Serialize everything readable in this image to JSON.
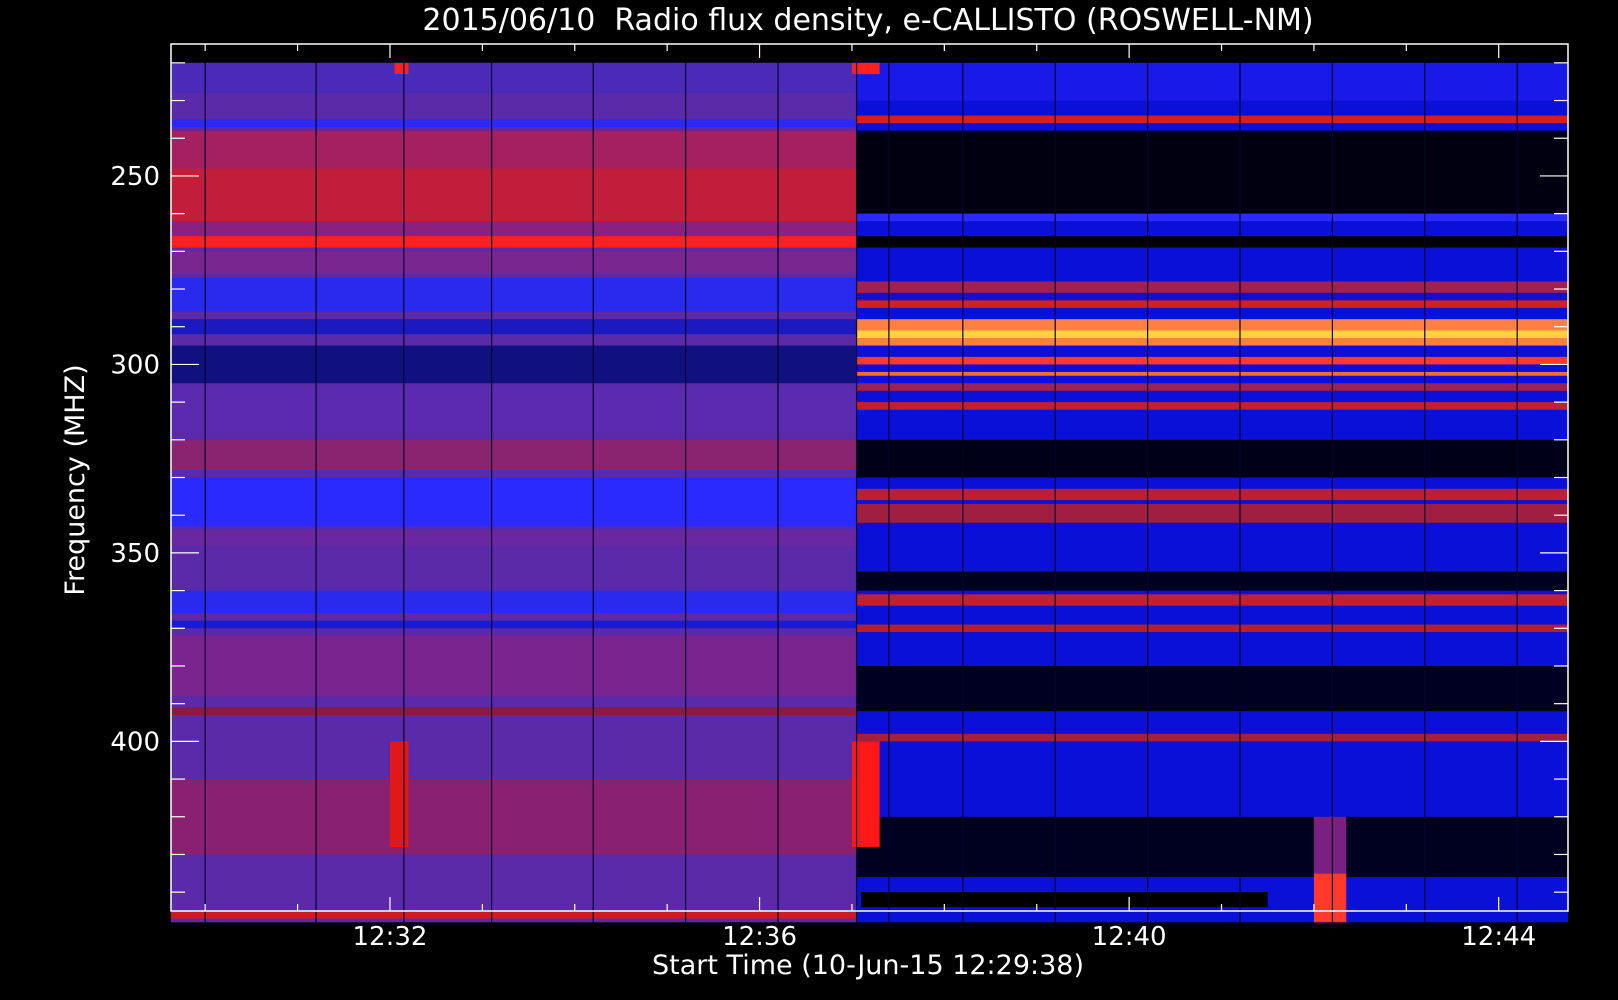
{
  "chart_data": {
    "type": "heatmap",
    "title": "2015/06/10  Radio flux density, e-CALLISTO (ROSWELL-NM)",
    "xlabel": "Start Time (10-Jun-15 12:29:38)",
    "ylabel": "Frequency (MHZ)",
    "x_ticks": [
      "12:32",
      "12:36",
      "12:40",
      "12:44"
    ],
    "y_ticks": [
      "250",
      "300",
      "350",
      "400"
    ],
    "x_tick_minutes": [
      32,
      36,
      40,
      44
    ],
    "y_tick_values": [
      250,
      300,
      350,
      400
    ],
    "xlim_minutes": [
      29.63,
      44.75
    ],
    "ylim_mhz": [
      445,
      215
    ],
    "y_inverted": true,
    "data_time_range_minutes": [
      29.63,
      44.75
    ],
    "data_freq_range_mhz": [
      220,
      448
    ],
    "colormap": [
      "#000000",
      "#0000ff",
      "#8020c0",
      "#ff0000",
      "#ffff00"
    ],
    "segments": [
      {
        "name": "before 12:37",
        "time_range_minutes": [
          29.63,
          37.05
        ],
        "background": "#5a2aa8",
        "bands": [
          {
            "freq_mhz": [
              220,
              228
            ],
            "color": "#4a2ab8"
          },
          {
            "freq_mhz": [
              235,
              237
            ],
            "color": "#2a2aff"
          },
          {
            "freq_mhz": [
              238,
              248
            ],
            "color": "#a42060"
          },
          {
            "freq_mhz": [
              248,
              262
            ],
            "color": "#c21e3a"
          },
          {
            "freq_mhz": [
              262,
              266
            ],
            "color": "#8a2080"
          },
          {
            "freq_mhz": [
              266,
              269
            ],
            "color": "#ff2020"
          },
          {
            "freq_mhz": [
              270,
              276
            ],
            "color": "#7a2690"
          },
          {
            "freq_mhz": [
              277,
              286
            ],
            "color": "#2a2aee"
          },
          {
            "freq_mhz": [
              288,
              292
            ],
            "color": "#1a1ac0"
          },
          {
            "freq_mhz": [
              295,
              305
            ],
            "color": "#101080"
          },
          {
            "freq_mhz": [
              306,
              318
            ],
            "color": "#5a2ab0"
          },
          {
            "freq_mhz": [
              320,
              328
            ],
            "color": "#8a2470"
          },
          {
            "freq_mhz": [
              330,
              343
            ],
            "color": "#2a2aff"
          },
          {
            "freq_mhz": [
              344,
              348
            ],
            "color": "#6a28a0"
          },
          {
            "freq_mhz": [
              360,
              366
            ],
            "color": "#2a2aee"
          },
          {
            "freq_mhz": [
              368,
              370
            ],
            "color": "#1a1ad0"
          },
          {
            "freq_mhz": [
              372,
              388
            ],
            "color": "#7a2490"
          },
          {
            "freq_mhz": [
              391,
              393
            ],
            "color": "#8a1a40"
          },
          {
            "freq_mhz": [
              410,
              430
            ],
            "color": "#8a2070"
          },
          {
            "freq_mhz": [
              445,
              447
            ],
            "color": "#d01a20"
          }
        ]
      },
      {
        "name": "after 12:37",
        "time_range_minutes": [
          37.05,
          44.75
        ],
        "background": "#0a10d8",
        "bands": [
          {
            "freq_mhz": [
              220,
              230
            ],
            "color": "#1a1ae8"
          },
          {
            "freq_mhz": [
              234,
              236
            ],
            "color": "#d02020"
          },
          {
            "freq_mhz": [
              238,
              260
            ],
            "color": "#000010"
          },
          {
            "freq_mhz": [
              260,
              262
            ],
            "color": "#2a2aff"
          },
          {
            "freq_mhz": [
              266,
              269
            ],
            "color": "#000000"
          },
          {
            "freq_mhz": [
              278,
              281
            ],
            "color": "#a02050"
          },
          {
            "freq_mhz": [
              283,
              285
            ],
            "color": "#d02020"
          },
          {
            "freq_mhz": [
              288,
              295
            ],
            "color": "#ff8040"
          },
          {
            "freq_mhz": [
              291,
              293
            ],
            "color": "#ffd040"
          },
          {
            "freq_mhz": [
              298,
              300
            ],
            "color": "#ff3a2a"
          },
          {
            "freq_mhz": [
              302,
              303
            ],
            "color": "#ff6a3a"
          },
          {
            "freq_mhz": [
              305,
              307
            ],
            "color": "#a02050"
          },
          {
            "freq_mhz": [
              310,
              312
            ],
            "color": "#c02030"
          },
          {
            "freq_mhz": [
              320,
              330
            ],
            "color": "#000018"
          },
          {
            "freq_mhz": [
              333,
              336
            ],
            "color": "#c01e30"
          },
          {
            "freq_mhz": [
              337,
              342
            ],
            "color": "#a01e40"
          },
          {
            "freq_mhz": [
              355,
              360
            ],
            "color": "#000020"
          },
          {
            "freq_mhz": [
              361,
              364
            ],
            "color": "#c02030"
          },
          {
            "freq_mhz": [
              369,
              371
            ],
            "color": "#b02030"
          },
          {
            "freq_mhz": [
              380,
              392
            ],
            "color": "#000022"
          },
          {
            "freq_mhz": [
              398,
              400
            ],
            "color": "#a02040"
          },
          {
            "freq_mhz": [
              420,
              436
            ],
            "color": "#000020"
          }
        ]
      }
    ],
    "bursts": [
      {
        "time_minutes": [
          32.05,
          32.2
        ],
        "freq_mhz": [
          220,
          223
        ],
        "color": "#ff2020"
      },
      {
        "time_minutes": [
          32.0,
          32.2
        ],
        "freq_mhz": [
          400,
          428
        ],
        "color": "#e01818"
      },
      {
        "time_minutes": [
          37.0,
          37.3
        ],
        "freq_mhz": [
          220,
          223
        ],
        "color": "#ff2020"
      },
      {
        "time_minutes": [
          37.0,
          37.3
        ],
        "freq_mhz": [
          400,
          428
        ],
        "color": "#ff1818"
      },
      {
        "time_minutes": [
          42.0,
          42.35
        ],
        "freq_mhz": [
          435,
          448
        ],
        "color": "#ff3a2a"
      },
      {
        "time_minutes": [
          42.0,
          42.35
        ],
        "freq_mhz": [
          420,
          435
        ],
        "color": "#7a2080"
      },
      {
        "time_minutes": [
          37.1,
          41.5
        ],
        "freq_mhz": [
          440,
          444
        ],
        "color": "#000000"
      }
    ],
    "vertical_lines_minutes": [
      30.0,
      31.2,
      32.15,
      33.1,
      34.2,
      35.2,
      36.2,
      37.05,
      37.4,
      38.2,
      39.2,
      40.2,
      41.2,
      42.2,
      43.2,
      44.2
    ],
    "grid": false
  }
}
